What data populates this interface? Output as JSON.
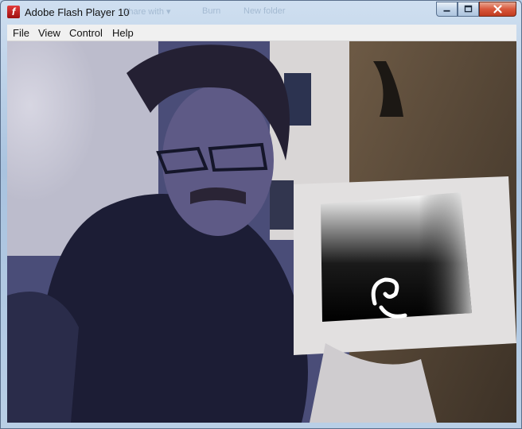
{
  "window": {
    "title": "Adobe Flash Player 10"
  },
  "titlebar_ghost": [
    "Share with ▾",
    "Burn",
    "New folder"
  ],
  "menubar": {
    "items": [
      "File",
      "View",
      "Control",
      "Help"
    ]
  },
  "icons": {
    "app": "flash-player-icon",
    "minimize": "minimize-icon",
    "maximize": "maximize-icon",
    "close": "close-icon"
  }
}
